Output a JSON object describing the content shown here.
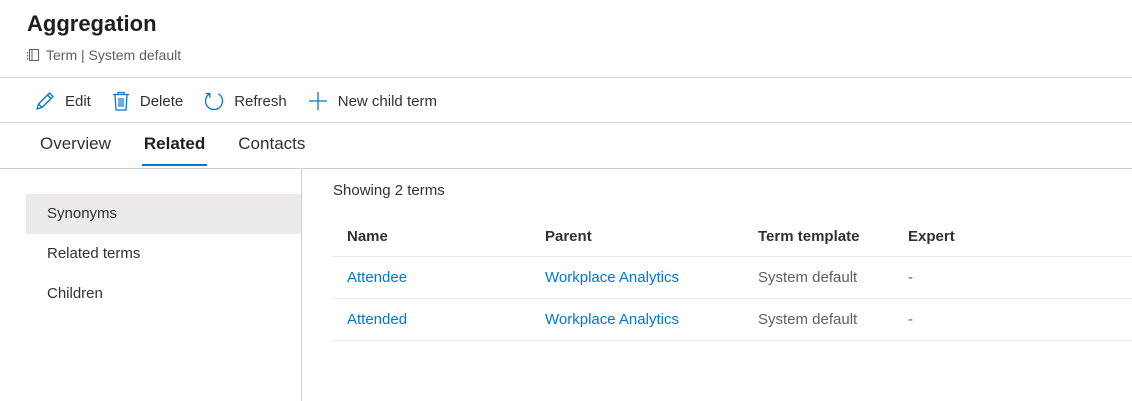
{
  "header": {
    "title": "Aggregation",
    "subtitle": "Term | System default",
    "subtitle_icon": "term-icon"
  },
  "toolbar": {
    "edit": "Edit",
    "delete": "Delete",
    "refresh": "Refresh",
    "new_child_term": "New child term"
  },
  "tabs": [
    {
      "label": "Overview",
      "active": false
    },
    {
      "label": "Related",
      "active": true
    },
    {
      "label": "Contacts",
      "active": false
    }
  ],
  "leftnav": {
    "items": [
      {
        "label": "Synonyms",
        "selected": true
      },
      {
        "label": "Related terms",
        "selected": false
      },
      {
        "label": "Children",
        "selected": false
      }
    ]
  },
  "main": {
    "showing": "Showing 2 terms",
    "columns": [
      "Name",
      "Parent",
      "Term template",
      "Expert"
    ],
    "rows": [
      {
        "name": "Attendee",
        "parent": "Workplace Analytics",
        "template": "System default",
        "expert": "-"
      },
      {
        "name": "Attended",
        "parent": "Workplace Analytics",
        "template": "System default",
        "expert": "-"
      }
    ]
  },
  "colors": {
    "accent": "#0078d4",
    "text": "#323130",
    "muted": "#605e5c",
    "selected_bg": "#edebe9",
    "divider": "#d2d0ce"
  }
}
